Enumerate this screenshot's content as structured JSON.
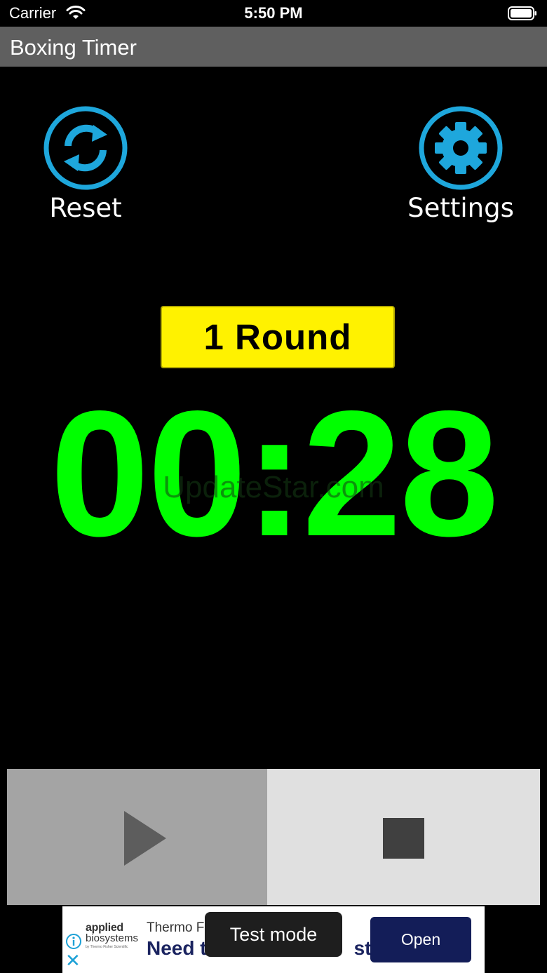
{
  "status_bar": {
    "carrier": "Carrier",
    "time": "5:50 PM"
  },
  "app": {
    "title": "Boxing Timer"
  },
  "controls": {
    "reset_label": "Reset",
    "settings_label": "Settings",
    "icon_color": "#1ea7dc"
  },
  "round": {
    "label": "1 Round",
    "badge_color": "#fff200"
  },
  "timer": {
    "display": "00:28",
    "color": "#00ff00"
  },
  "watermark": "UpdateStar.com",
  "playback": {
    "play_icon": "play-icon",
    "stop_icon": "stop-icon"
  },
  "ad": {
    "logo_line1": "applied",
    "logo_line2": "biosystems",
    "logo_line3": "by Thermo Fisher Scientific",
    "brand": "Thermo Fi",
    "headline": "Need t",
    "headline_tail": "st",
    "open_label": "Open",
    "toast": "Test mode"
  }
}
